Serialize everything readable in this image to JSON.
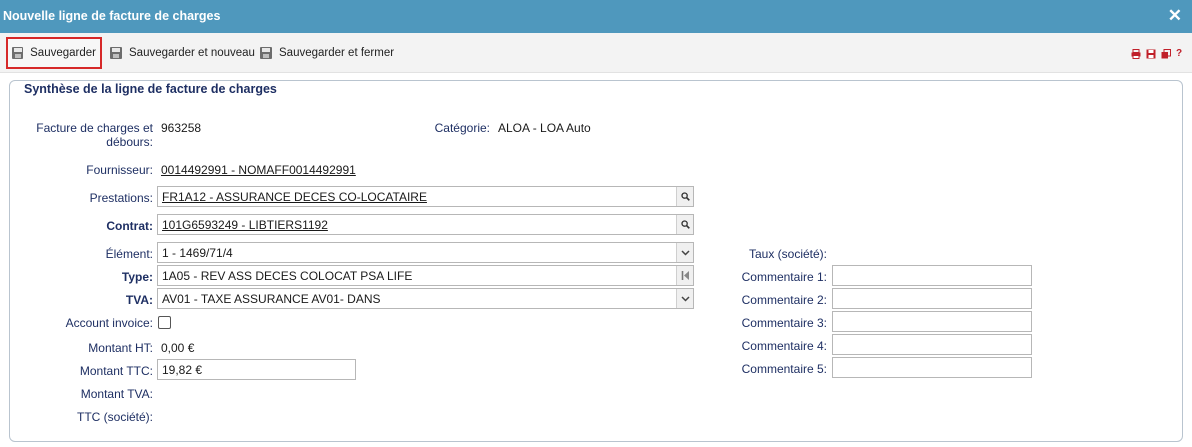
{
  "window": {
    "title": "Nouvelle ligne de facture de charges",
    "close_glyph": "✕"
  },
  "toolbar": {
    "save_label": "Sauvegarder",
    "save_new_label": "Sauvegarder et nouveau",
    "save_close_label": "Sauvegarder et fermer",
    "right_icons": [
      "print-icon",
      "save-icon",
      "print-preview-icon",
      "help-icon"
    ],
    "help_glyph": "?"
  },
  "section": {
    "title": "Synthèse de la ligne de facture de charges"
  },
  "form": {
    "facture_label": "Facture de charges et débours:",
    "facture_value": "963258",
    "categorie_label": "Catégorie:",
    "categorie_value": "ALOA - LOA Auto",
    "fournisseur_label": "Fournisseur:",
    "fournisseur_value": "0014492991 - NOMAFF0014492991",
    "prestations_label": "Prestations:",
    "prestations_value": "FR1A12 - ASSURANCE DECES CO-LOCATAIRE",
    "contrat_label": "Contrat:",
    "contrat_value": "101G6593249 - LIBTIERS1192",
    "element_label": "Élément:",
    "element_value": "1 - 1469/71/4",
    "type_label": "Type:",
    "type_value": "1A05 - REV ASS DECES COLOCAT PSA LIFE",
    "tva_label": "TVA:",
    "tva_value": "AV01 - TAXE ASSURANCE AV01- DANS",
    "account_invoice_label": "Account invoice:",
    "account_invoice_checked": false,
    "montant_ht_label": "Montant HT:",
    "montant_ht_value": "0,00 €",
    "montant_ttc_label": "Montant TTC:",
    "montant_ttc_value": "19,82 €",
    "montant_tva_label": "Montant TVA:",
    "ttc_societe_label": "TTC (société):",
    "taux_societe_label": "Taux (société):",
    "commentaire1_label": "Commentaire 1:",
    "commentaire2_label": "Commentaire 2:",
    "commentaire3_label": "Commentaire 3:",
    "commentaire4_label": "Commentaire 4:",
    "commentaire5_label": "Commentaire 5:",
    "commentaire1_value": "",
    "commentaire2_value": "",
    "commentaire3_value": "",
    "commentaire4_value": "",
    "commentaire5_value": ""
  },
  "colors": {
    "titlebar": "#4f98bd",
    "label": "#1e2f63",
    "active_outline": "#d62828",
    "icon_red": "#c0202a"
  }
}
